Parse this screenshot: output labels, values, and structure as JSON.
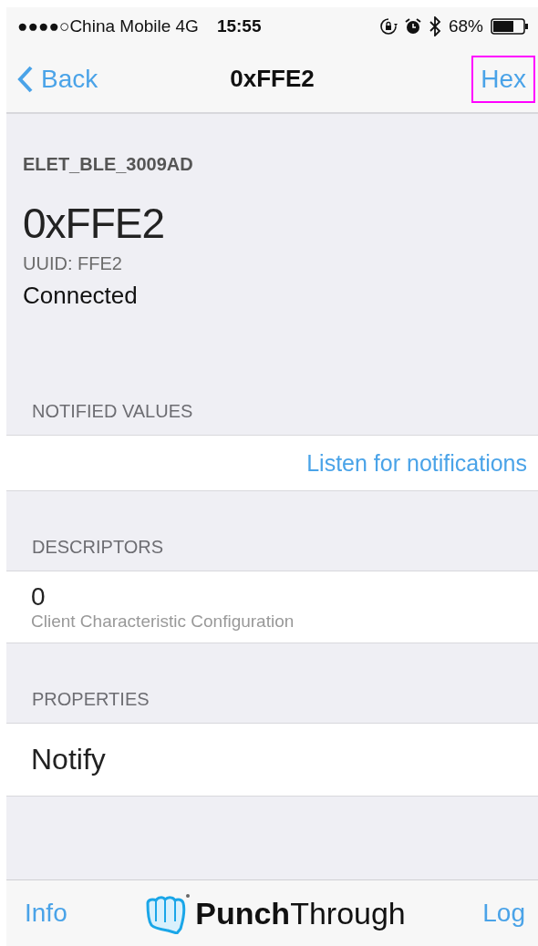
{
  "status_bar": {
    "carrier": "●●●●○China Mobile 4G",
    "time": "15:55",
    "battery_percent": "68%"
  },
  "nav_bar": {
    "back": "Back",
    "title": "0xFFE2",
    "right_button": {
      "label": "Hex",
      "highlighted": true
    }
  },
  "header": {
    "device": "ELET_BLE_3009AD",
    "name": "0xFFE2",
    "uuid": "UUID: FFE2",
    "state": "Connected"
  },
  "sections": [
    {
      "title": "NOTIFIED VALUES",
      "rows": [
        {
          "kind": "action",
          "label": "Listen for notifications"
        }
      ]
    },
    {
      "title": "DESCRIPTORS",
      "rows": [
        {
          "kind": "detail",
          "value": "0",
          "subtitle": "Client Characteristic Configuration"
        }
      ]
    },
    {
      "title": "PROPERTIES",
      "rows": [
        {
          "kind": "plain",
          "label": "Notify"
        }
      ]
    }
  ],
  "tab_bar": {
    "left": "Info",
    "logo_bold": "Punch",
    "logo_light": "Through",
    "right": "Log"
  }
}
